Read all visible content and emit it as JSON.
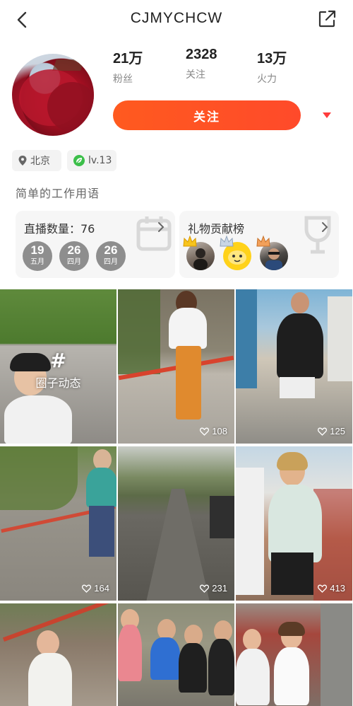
{
  "header": {
    "title": "CJMYCHCW"
  },
  "profile": {
    "stats": [
      {
        "value": "21万",
        "label": "粉丝"
      },
      {
        "value": "2328",
        "label": "关注"
      },
      {
        "value": "13万",
        "label": "火力"
      }
    ],
    "follow_label": "关注",
    "location": "北京",
    "level": "lv.13",
    "bio": "简单的工作用语"
  },
  "live_card": {
    "title": "直播数量：76",
    "dates": [
      {
        "day": "19",
        "month": "五月"
      },
      {
        "day": "26",
        "month": "四月"
      },
      {
        "day": "26",
        "month": "四月"
      }
    ]
  },
  "gift_card": {
    "title": "礼物贡献榜"
  },
  "grid": {
    "circle_label": "圈子动态",
    "circle_hash": "#",
    "likes": [
      "108",
      "125",
      "164",
      "231",
      "413"
    ]
  },
  "colors": {
    "accent": "#ff5a1f",
    "dropdown": "#ff3b3b",
    "level_green": "#3cbf4a"
  }
}
